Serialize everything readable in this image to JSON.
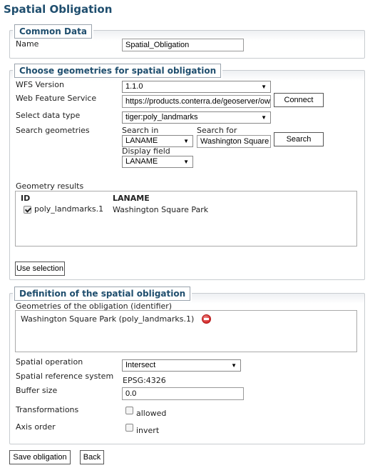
{
  "page_title": "Spatial Obligation",
  "common": {
    "legend": "Common Data",
    "name_label": "Name",
    "name_value": "Spatial_Obligation"
  },
  "geometries": {
    "legend": "Choose geometries for spatial obligation",
    "wfs_version_label": "WFS Version",
    "wfs_version_value": "1.1.0",
    "wfs_label": "Web Feature Service",
    "wfs_value": "https://products.conterra.de/geoserver/ows",
    "connect_label": "Connect",
    "data_type_label": "Select data type",
    "data_type_value": "tiger:poly_landmarks",
    "search_label": "Search geometries",
    "search_in_label": "Search in",
    "search_in_value": "LANAME",
    "search_for_label": "Search for",
    "search_for_value": "Washington Square Park",
    "search_button": "Search",
    "display_field_label": "Display field",
    "display_field_value": "LANAME",
    "results_label": "Geometry results",
    "results_columns": [
      "ID",
      "LANAME"
    ],
    "results_rows": [
      {
        "id": "poly_landmarks.1",
        "laname": "Washington Square Park",
        "checked": true
      }
    ],
    "use_selection": "Use selection"
  },
  "definition": {
    "legend": "Definition of the spatial obligation",
    "geometries_label": "Geometries of the obligation (identifier)",
    "geometry_item": "Washington Square Park (poly_landmarks.1)",
    "spatial_op_label": "Spatial operation",
    "spatial_op_value": "Intersect",
    "srs_label": "Spatial reference system",
    "srs_value": "EPSG:4326",
    "buffer_label": "Buffer size",
    "buffer_value": "0.0",
    "transformations_label": "Transformations",
    "transformations_option": "allowed",
    "axis_label": "Axis order",
    "axis_option": "invert"
  },
  "footer": {
    "save": "Save obligation",
    "back": "Back"
  }
}
